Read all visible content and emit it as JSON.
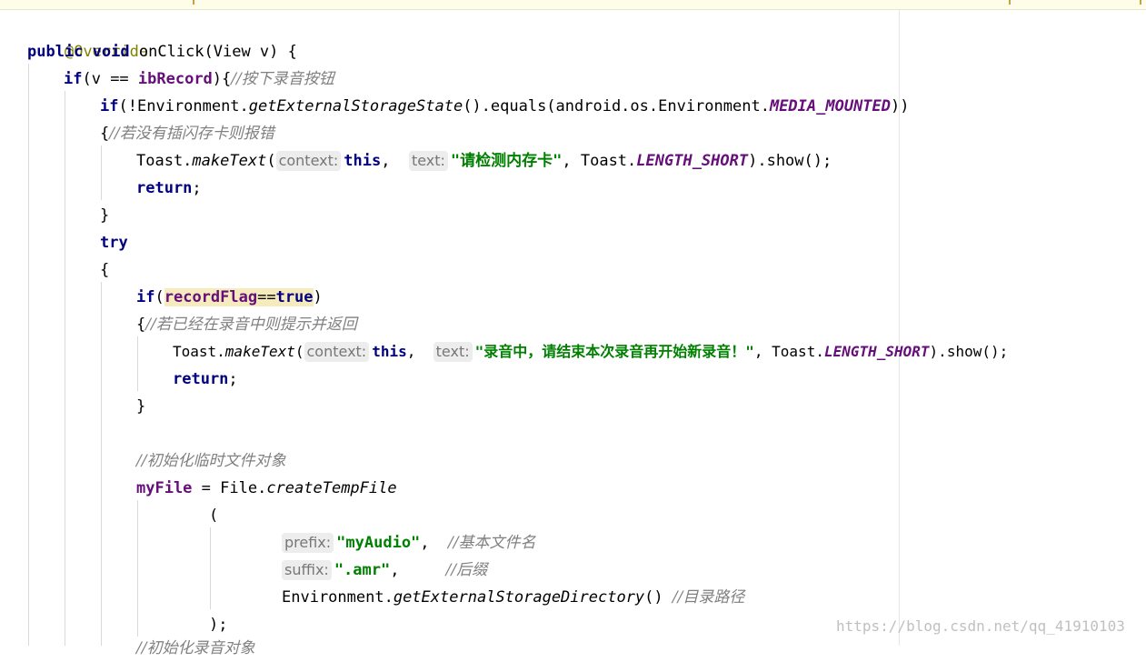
{
  "code": {
    "l1": {
      "annotation": "@Override"
    },
    "l2": {
      "kw_public": "public",
      "kw_void": "void",
      "rest": " onClick(View v) {"
    },
    "l3": {
      "kw_if": "if",
      "p1": "(v == ",
      "field": "ibRecord",
      "p2": "){",
      "comment": "//按下录音按钮"
    },
    "l4": {
      "kw_if": "if",
      "p1": "(!Environment.",
      "method": "getExternalStorageState",
      "p2": "().equals(android.os.Environment.",
      "constant": "MEDIA_MOUNTED",
      "p3": "))"
    },
    "l5": {
      "brace": "{",
      "comment": "//若没有插闪存卡则报错"
    },
    "l6": {
      "p1": "Toast.",
      "method": "makeText",
      "p2": "(",
      "hint_context": "context:",
      "kw_this": "this",
      "p3": ",  ",
      "hint_text": "text:",
      "string": "\"请检测内存卡\"",
      "p4": ", Toast.",
      "constant": "LENGTH_SHORT",
      "p5": ").show();"
    },
    "l7": {
      "kw_return": "return",
      "p1": ";"
    },
    "l8": {
      "brace": "}"
    },
    "l9": {
      "kw_try": "try"
    },
    "l10": {
      "brace": "{"
    },
    "l11": {
      "kw_if": "if",
      "p1": "(",
      "field": "recordFlag",
      "p2": "==",
      "kw_true": "true",
      "p3": ")"
    },
    "l12": {
      "brace": "{",
      "comment": "//若已经在录音中则提示并返回"
    },
    "l13": {
      "p1": "Toast.",
      "method": "makeText",
      "p2": "(",
      "hint_context": "context:",
      "kw_this": "this",
      "p3": ",  ",
      "hint_text": "text:",
      "string": "\"录音中，请结束本次录音再开始新录音！\"",
      "p4": ", Toast.",
      "constant": "LENGTH_SHORT",
      "p5": ").show();"
    },
    "l14": {
      "kw_return": "return",
      "p1": ";"
    },
    "l15": {
      "brace": "}"
    },
    "l17": {
      "comment": "//初始化临时文件对象"
    },
    "l18": {
      "field": "myFile",
      "p1": " = File.",
      "method": "createTempFile"
    },
    "l19": {
      "p1": "("
    },
    "l20": {
      "hint": "prefix:",
      "string": "\"myAudio\"",
      "p1": ",  ",
      "comment": "//基本文件名"
    },
    "l21": {
      "hint": "suffix:",
      "string": "\".amr\"",
      "p1": ",     ",
      "comment": "//后缀"
    },
    "l22": {
      "p1": "Environment.",
      "method": "getExternalStorageDirectory",
      "p2": "() ",
      "comment": "//目录路径"
    },
    "l23": {
      "p1": ");"
    },
    "l24": {
      "comment": "//初始化录音对象"
    }
  },
  "watermark": "https://blog.csdn.net/qq_41910103",
  "colors": {
    "keyword": "#000080",
    "annotation": "#808000",
    "comment": "#808080",
    "string": "#008000",
    "field": "#660e7a",
    "highlight": "#f6ebbc"
  }
}
